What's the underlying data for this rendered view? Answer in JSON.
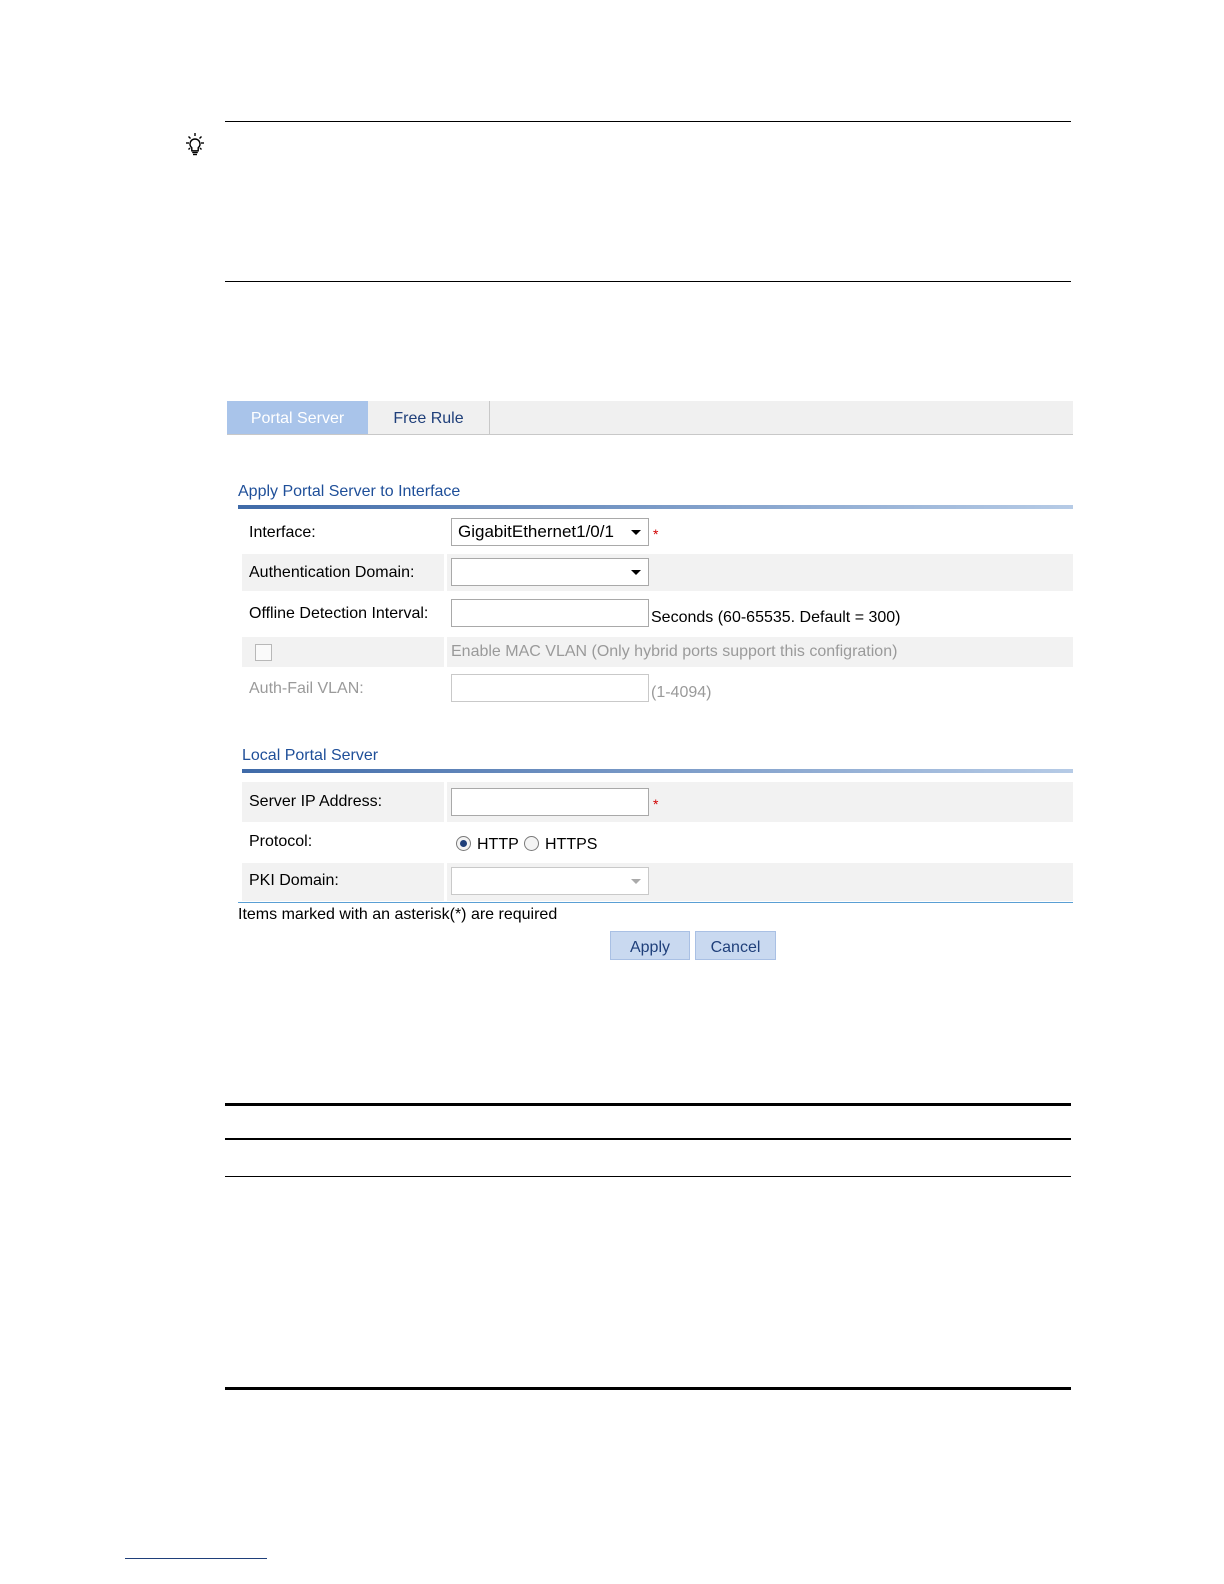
{
  "tabs": [
    {
      "label": "Portal Server",
      "active": true
    },
    {
      "label": "Free Rule",
      "active": false
    }
  ],
  "apply_section": {
    "title": "Apply Portal Server to Interface",
    "interface_label": "Interface:",
    "interface_value": "GigabitEthernet1/0/1",
    "auth_domain_label": "Authentication Domain:",
    "auth_domain_value": "",
    "offline_label": "Offline Detection Interval:",
    "offline_value": "",
    "offline_hint": "Seconds (60-65535. Default = 300)",
    "mac_vlan_label": "Enable MAC VLAN (Only hybrid ports support this configration)",
    "mac_vlan_checked": false,
    "auth_fail_label": "Auth-Fail VLAN:",
    "auth_fail_value": "",
    "auth_fail_hint": "(1-4094)"
  },
  "local_section": {
    "title": "Local Portal Server",
    "server_ip_label": "Server IP Address:",
    "server_ip_value": "",
    "protocol_label": "Protocol:",
    "protocol_options": [
      "HTTP",
      "HTTPS"
    ],
    "protocol_selected": "HTTP",
    "pki_label": "PKI Domain:",
    "pki_value": ""
  },
  "required_star": "*",
  "required_note": "Items marked with an asterisk(*) are required",
  "buttons": {
    "apply": "Apply",
    "cancel": "Cancel"
  },
  "colors": {
    "accent": "#1f4f99",
    "tab_active": "#a9c4ea",
    "required": "#d00000"
  }
}
